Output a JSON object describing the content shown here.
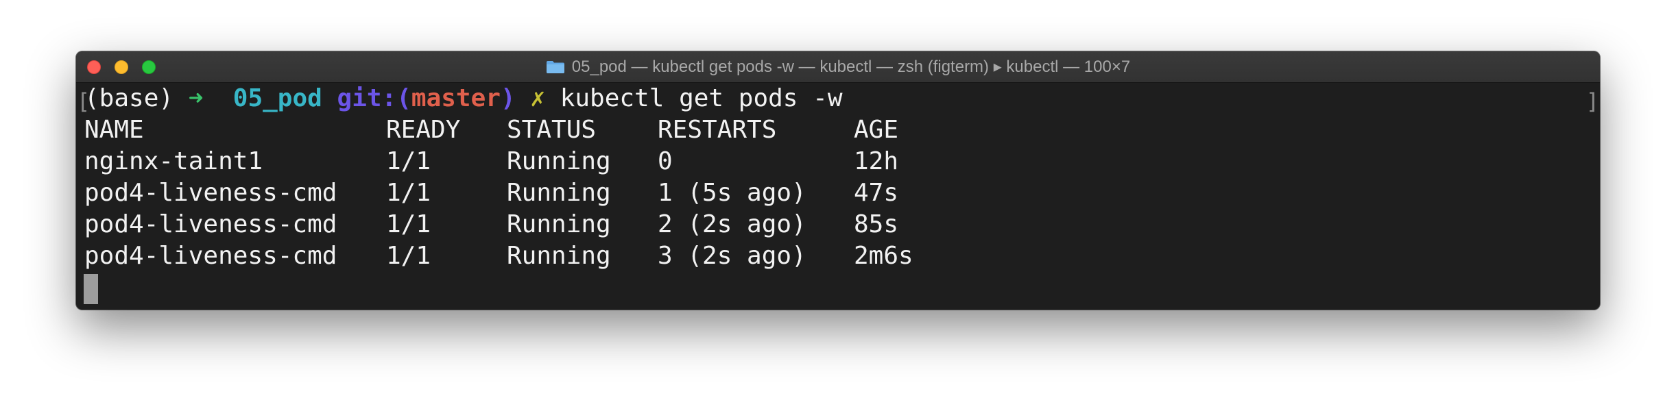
{
  "window": {
    "title": "05_pod — kubectl get pods -w — kubectl — zsh (figterm) ▸ kubectl — 100×7"
  },
  "prompt": {
    "env": "(base)",
    "arrow": "➜",
    "dir": "05_pod",
    "git_label": "git:(",
    "branch": "master",
    "git_close": ")",
    "dirty_mark": "✗",
    "command": "kubectl get pods -w"
  },
  "table": {
    "headers": [
      "NAME",
      "READY",
      "STATUS",
      "RESTARTS",
      "AGE"
    ],
    "rows": [
      [
        "nginx-taint1",
        "1/1",
        "Running",
        "0",
        "12h"
      ],
      [
        "pod4-liveness-cmd",
        "1/1",
        "Running",
        "1 (5s ago)",
        "47s"
      ],
      [
        "pod4-liveness-cmd",
        "1/1",
        "Running",
        "2 (2s ago)",
        "85s"
      ],
      [
        "pod4-liveness-cmd",
        "1/1",
        "Running",
        "3 (2s ago)",
        "2m6s"
      ]
    ]
  },
  "colors": {
    "arrow": "#39c26a",
    "dir": "#38b6c7",
    "git": "#6c55e8",
    "branch": "#e0604c",
    "dirty_mark": "#c8c234"
  }
}
